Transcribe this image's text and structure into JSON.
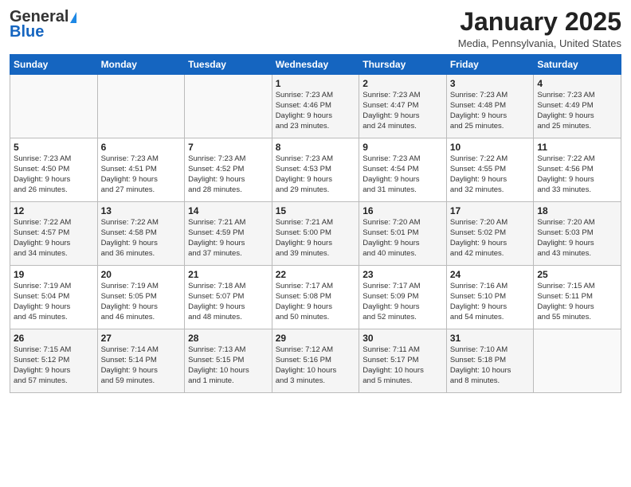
{
  "header": {
    "logo_line1": "General",
    "logo_line2": "Blue",
    "month": "January 2025",
    "location": "Media, Pennsylvania, United States"
  },
  "weekdays": [
    "Sunday",
    "Monday",
    "Tuesday",
    "Wednesday",
    "Thursday",
    "Friday",
    "Saturday"
  ],
  "weeks": [
    [
      {
        "day": "",
        "info": ""
      },
      {
        "day": "",
        "info": ""
      },
      {
        "day": "",
        "info": ""
      },
      {
        "day": "1",
        "info": "Sunrise: 7:23 AM\nSunset: 4:46 PM\nDaylight: 9 hours\nand 23 minutes."
      },
      {
        "day": "2",
        "info": "Sunrise: 7:23 AM\nSunset: 4:47 PM\nDaylight: 9 hours\nand 24 minutes."
      },
      {
        "day": "3",
        "info": "Sunrise: 7:23 AM\nSunset: 4:48 PM\nDaylight: 9 hours\nand 25 minutes."
      },
      {
        "day": "4",
        "info": "Sunrise: 7:23 AM\nSunset: 4:49 PM\nDaylight: 9 hours\nand 25 minutes."
      }
    ],
    [
      {
        "day": "5",
        "info": "Sunrise: 7:23 AM\nSunset: 4:50 PM\nDaylight: 9 hours\nand 26 minutes."
      },
      {
        "day": "6",
        "info": "Sunrise: 7:23 AM\nSunset: 4:51 PM\nDaylight: 9 hours\nand 27 minutes."
      },
      {
        "day": "7",
        "info": "Sunrise: 7:23 AM\nSunset: 4:52 PM\nDaylight: 9 hours\nand 28 minutes."
      },
      {
        "day": "8",
        "info": "Sunrise: 7:23 AM\nSunset: 4:53 PM\nDaylight: 9 hours\nand 29 minutes."
      },
      {
        "day": "9",
        "info": "Sunrise: 7:23 AM\nSunset: 4:54 PM\nDaylight: 9 hours\nand 31 minutes."
      },
      {
        "day": "10",
        "info": "Sunrise: 7:22 AM\nSunset: 4:55 PM\nDaylight: 9 hours\nand 32 minutes."
      },
      {
        "day": "11",
        "info": "Sunrise: 7:22 AM\nSunset: 4:56 PM\nDaylight: 9 hours\nand 33 minutes."
      }
    ],
    [
      {
        "day": "12",
        "info": "Sunrise: 7:22 AM\nSunset: 4:57 PM\nDaylight: 9 hours\nand 34 minutes."
      },
      {
        "day": "13",
        "info": "Sunrise: 7:22 AM\nSunset: 4:58 PM\nDaylight: 9 hours\nand 36 minutes."
      },
      {
        "day": "14",
        "info": "Sunrise: 7:21 AM\nSunset: 4:59 PM\nDaylight: 9 hours\nand 37 minutes."
      },
      {
        "day": "15",
        "info": "Sunrise: 7:21 AM\nSunset: 5:00 PM\nDaylight: 9 hours\nand 39 minutes."
      },
      {
        "day": "16",
        "info": "Sunrise: 7:20 AM\nSunset: 5:01 PM\nDaylight: 9 hours\nand 40 minutes."
      },
      {
        "day": "17",
        "info": "Sunrise: 7:20 AM\nSunset: 5:02 PM\nDaylight: 9 hours\nand 42 minutes."
      },
      {
        "day": "18",
        "info": "Sunrise: 7:20 AM\nSunset: 5:03 PM\nDaylight: 9 hours\nand 43 minutes."
      }
    ],
    [
      {
        "day": "19",
        "info": "Sunrise: 7:19 AM\nSunset: 5:04 PM\nDaylight: 9 hours\nand 45 minutes."
      },
      {
        "day": "20",
        "info": "Sunrise: 7:19 AM\nSunset: 5:05 PM\nDaylight: 9 hours\nand 46 minutes."
      },
      {
        "day": "21",
        "info": "Sunrise: 7:18 AM\nSunset: 5:07 PM\nDaylight: 9 hours\nand 48 minutes."
      },
      {
        "day": "22",
        "info": "Sunrise: 7:17 AM\nSunset: 5:08 PM\nDaylight: 9 hours\nand 50 minutes."
      },
      {
        "day": "23",
        "info": "Sunrise: 7:17 AM\nSunset: 5:09 PM\nDaylight: 9 hours\nand 52 minutes."
      },
      {
        "day": "24",
        "info": "Sunrise: 7:16 AM\nSunset: 5:10 PM\nDaylight: 9 hours\nand 54 minutes."
      },
      {
        "day": "25",
        "info": "Sunrise: 7:15 AM\nSunset: 5:11 PM\nDaylight: 9 hours\nand 55 minutes."
      }
    ],
    [
      {
        "day": "26",
        "info": "Sunrise: 7:15 AM\nSunset: 5:12 PM\nDaylight: 9 hours\nand 57 minutes."
      },
      {
        "day": "27",
        "info": "Sunrise: 7:14 AM\nSunset: 5:14 PM\nDaylight: 9 hours\nand 59 minutes."
      },
      {
        "day": "28",
        "info": "Sunrise: 7:13 AM\nSunset: 5:15 PM\nDaylight: 10 hours\nand 1 minute."
      },
      {
        "day": "29",
        "info": "Sunrise: 7:12 AM\nSunset: 5:16 PM\nDaylight: 10 hours\nand 3 minutes."
      },
      {
        "day": "30",
        "info": "Sunrise: 7:11 AM\nSunset: 5:17 PM\nDaylight: 10 hours\nand 5 minutes."
      },
      {
        "day": "31",
        "info": "Sunrise: 7:10 AM\nSunset: 5:18 PM\nDaylight: 10 hours\nand 8 minutes."
      },
      {
        "day": "",
        "info": ""
      }
    ]
  ]
}
